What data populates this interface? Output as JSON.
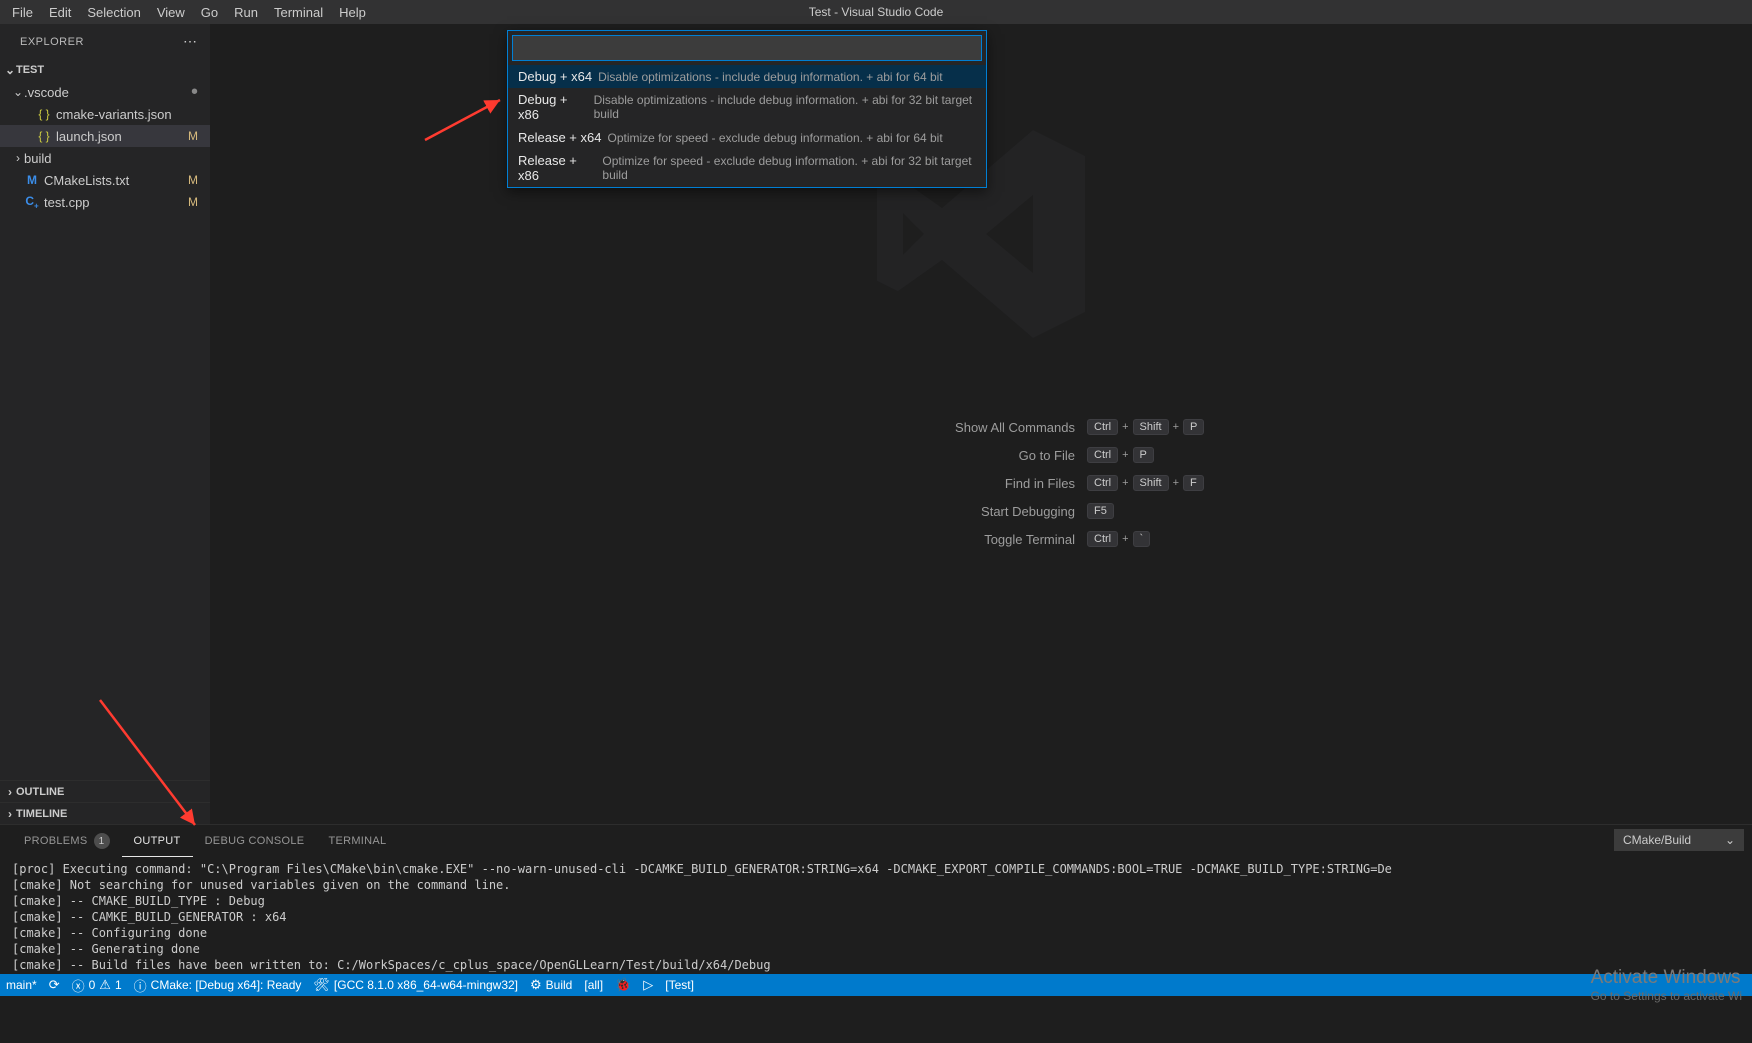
{
  "menubar": {
    "items": [
      "File",
      "Edit",
      "Selection",
      "View",
      "Go",
      "Run",
      "Terminal",
      "Help"
    ],
    "title": "Test - Visual Studio Code"
  },
  "sidebar": {
    "header": "EXPLORER",
    "project": "TEST",
    "items": [
      {
        "type": "folder",
        "name": ".vscode",
        "open": true,
        "status": "dot"
      },
      {
        "type": "file",
        "name": "cmake-variants.json",
        "icon": "json",
        "indent": 2
      },
      {
        "type": "file",
        "name": "launch.json",
        "icon": "json",
        "indent": 2,
        "status": "M",
        "selected": true
      },
      {
        "type": "folder",
        "name": "build",
        "open": false,
        "indent": 1
      },
      {
        "type": "file",
        "name": "CMakeLists.txt",
        "icon": "cmake",
        "indent": 1,
        "status": "M"
      },
      {
        "type": "file",
        "name": "test.cpp",
        "icon": "cpp",
        "indent": 1,
        "status": "M"
      }
    ],
    "outline": "OUTLINE",
    "timeline": "TIMELINE"
  },
  "quickpick": {
    "items": [
      {
        "primary": "Debug + x64",
        "desc": "Disable optimizations - include debug information. + abi for 64 bit",
        "selected": true
      },
      {
        "primary": "Debug + x86",
        "desc": "Disable optimizations - include debug information. + abi for 32 bit target build"
      },
      {
        "primary": "Release + x64",
        "desc": "Optimize for speed - exclude debug information. + abi for 64 bit"
      },
      {
        "primary": "Release + x86",
        "desc": "Optimize for speed - exclude debug information. + abi for 32 bit target build"
      }
    ]
  },
  "shortcuts": [
    {
      "label": "Show All Commands",
      "keys": [
        "Ctrl",
        "+",
        "Shift",
        "+",
        "P"
      ]
    },
    {
      "label": "Go to File",
      "keys": [
        "Ctrl",
        "+",
        "P"
      ]
    },
    {
      "label": "Find in Files",
      "keys": [
        "Ctrl",
        "+",
        "Shift",
        "+",
        "F"
      ]
    },
    {
      "label": "Start Debugging",
      "keys": [
        "F5"
      ]
    },
    {
      "label": "Toggle Terminal",
      "keys": [
        "Ctrl",
        "+",
        "`"
      ]
    }
  ],
  "panel": {
    "tabs": {
      "problems": "PROBLEMS",
      "problems_count": "1",
      "output": "OUTPUT",
      "debug": "DEBUG CONSOLE",
      "terminal": "TERMINAL"
    },
    "channel": "CMake/Build",
    "lines": [
      "[proc] Executing command: \"C:\\Program Files\\CMake\\bin\\cmake.EXE\" --no-warn-unused-cli -DCAMKE_BUILD_GENERATOR:STRING=x64 -DCMAKE_EXPORT_COMPILE_COMMANDS:BOOL=TRUE -DCMAKE_BUILD_TYPE:STRING=De",
      "[cmake] Not searching for unused variables given on the command line.",
      "[cmake] -- CMAKE_BUILD_TYPE : Debug",
      "[cmake] -- CAMKE_BUILD_GENERATOR : x64",
      "[cmake] -- Configuring done",
      "[cmake] -- Generating done",
      "[cmake] -- Build files have been written to: C:/WorkSpaces/c_cplus_space/OpenGLLearn/Test/build/x64/Debug"
    ]
  },
  "activate": {
    "h": "Activate Windows",
    "s": "Go to Settings to activate Wi"
  },
  "status": {
    "branch": "main*",
    "errors": "0",
    "warnings": "1",
    "cmake": "CMake: [Debug x64]: Ready",
    "kit": "[GCC 8.1.0 x86_64-w64-mingw32]",
    "build": "Build",
    "target": "[all]",
    "run_target": "[Test]"
  }
}
